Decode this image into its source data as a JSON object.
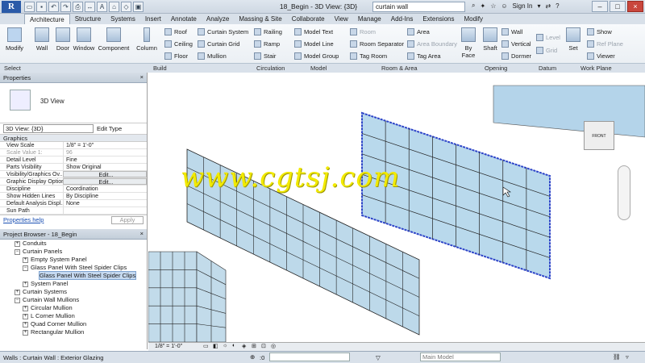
{
  "titlebar": {
    "logo": "R",
    "title": "18_Begin - 3D View: {3D}",
    "search_value": "curtain wall",
    "signin": "Sign In"
  },
  "tabs": [
    "Architecture",
    "Structure",
    "Systems",
    "Insert",
    "Annotate",
    "Analyze",
    "Massing & Site",
    "Collaborate",
    "View",
    "Manage",
    "Add-Ins",
    "Extensions",
    "Modify"
  ],
  "ribbon": {
    "modify": "Modify",
    "wall": "Wall",
    "door": "Door",
    "window": "Window",
    "component": "Component",
    "column": "Column",
    "roof": "Roof",
    "ceiling": "Ceiling",
    "floor": "Floor",
    "curtain_system": "Curtain System",
    "curtain_grid": "Curtain Grid",
    "mullion": "Mullion",
    "railing": "Railing",
    "ramp": "Ramp",
    "stair": "Stair",
    "model_text": "Model Text",
    "model_line": "Model Line",
    "model_group": "Model Group",
    "room": "Room",
    "room_separator": "Room Separator",
    "tag_room": "Tag Room",
    "area": "Area",
    "area_boundary": "Area Boundary",
    "tag_area": "Tag Area",
    "by_face": "By Face",
    "shaft": "Shaft",
    "wall_opening": "Wall",
    "vertical": "Vertical",
    "dormer": "Dormer",
    "level": "Level",
    "grid": "Grid",
    "set": "Set",
    "show": "Show",
    "ref_plane": "Ref Plane",
    "viewer": "Viewer",
    "panels": [
      "Select",
      "Build",
      "Circulation",
      "Model",
      "Room & Area",
      "Opening",
      "Datum",
      "Work Plane"
    ]
  },
  "properties": {
    "title": "Properties",
    "type_name": "3D View",
    "instance_select": "3D View: {3D}",
    "edit_type": "Edit Type",
    "group": "Graphics",
    "rows": [
      {
        "k": "View Scale",
        "v": "1/8\" = 1'-0\""
      },
      {
        "k": "Scale Value    1:",
        "v": "96"
      },
      {
        "k": "Detail Level",
        "v": "Fine"
      },
      {
        "k": "Parts Visibility",
        "v": "Show Original"
      },
      {
        "k": "Visibility/Graphics Ov...",
        "v": "Edit..."
      },
      {
        "k": "Graphic Display Options",
        "v": "Edit..."
      },
      {
        "k": "Discipline",
        "v": "Coordination"
      },
      {
        "k": "Show Hidden Lines",
        "v": "By Discipline"
      },
      {
        "k": "Default Analysis Displ...",
        "v": "None"
      },
      {
        "k": "Sun Path",
        "v": ""
      }
    ],
    "help": "Properties help",
    "apply": "Apply"
  },
  "browser": {
    "title": "Project Browser - 18_Begin",
    "items": [
      {
        "label": "Conduits",
        "level": 1,
        "pm": "+"
      },
      {
        "label": "Curtain Panels",
        "level": 1,
        "pm": "-"
      },
      {
        "label": "Empty System Panel",
        "level": 2,
        "pm": "+"
      },
      {
        "label": "Glass Panel With Steel Spider Clips",
        "level": 2,
        "pm": "-"
      },
      {
        "label": "Glass Panel With Steel Spider Clips",
        "level": 3,
        "pm": "",
        "sel": true
      },
      {
        "label": "System Panel",
        "level": 2,
        "pm": "+"
      },
      {
        "label": "Curtain Systems",
        "level": 1,
        "pm": "+"
      },
      {
        "label": "Curtain Wall Mullions",
        "level": 1,
        "pm": "-"
      },
      {
        "label": "Circular Mullion",
        "level": 2,
        "pm": "+"
      },
      {
        "label": "L Corner Mullion",
        "level": 2,
        "pm": "+"
      },
      {
        "label": "Quad Corner Mullion",
        "level": 2,
        "pm": "+"
      },
      {
        "label": "Rectangular Mullion",
        "level": 2,
        "pm": "+"
      }
    ]
  },
  "viewbar": {
    "scale": "1/8\" = 1'-0\""
  },
  "status": {
    "text": "Walls : Curtain Wall : Exterior Glazing",
    "zero": ":0",
    "model": "Main Model"
  },
  "watermark": "www.cgtsj.com",
  "viewcube": "FRONT"
}
